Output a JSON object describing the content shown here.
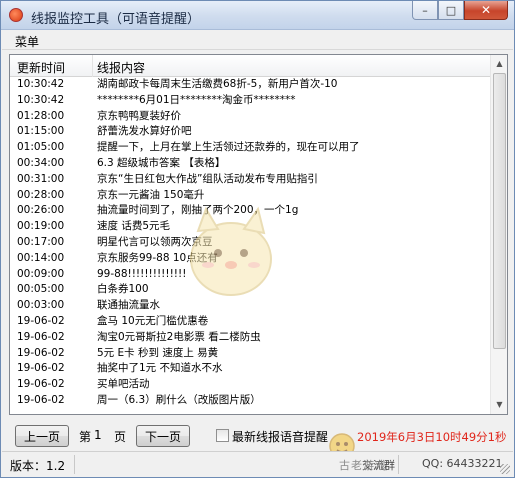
{
  "window": {
    "title": "线报监控工具（可语音提醒）",
    "buttons": {
      "minimize": "–",
      "maximize": "□",
      "close": "✕"
    }
  },
  "menu": {
    "items": [
      "菜单"
    ]
  },
  "list": {
    "columns": [
      "更新时间",
      "线报内容"
    ],
    "rows": [
      [
        "10:30:42",
        "湖南邮政卡每周末生活缴费68折-5，新用户首次-10"
      ],
      [
        "10:30:42",
        "********6月01日********淘金币********"
      ],
      [
        "01:28:00",
        "京东鸭鸭夏装好价"
      ],
      [
        "01:15:00",
        "舒蕾洗发水算好价吧"
      ],
      [
        "01:05:00",
        "提醒一下，上月在掌上生活领过还款券的，现在可以用了"
      ],
      [
        "00:34:00",
        "6.3 超级城市答案 【表格】"
      ],
      [
        "00:31:00",
        "京东“生日红包大作战”组队活动发布专用贴指引"
      ],
      [
        "00:28:00",
        "京东一元酱油 150毫升"
      ],
      [
        "00:26:00",
        "抽流量时间到了，刚抽了两个200，一个1g"
      ],
      [
        "00:19:00",
        "速度 话费5元毛"
      ],
      [
        "00:17:00",
        "明星代言可以领两次京豆"
      ],
      [
        "00:14:00",
        "京东服务99-88 10点还有"
      ],
      [
        "00:09:00",
        "99-88!!!!!!!!!!!!!!"
      ],
      [
        "00:05:00",
        "白条券100"
      ],
      [
        "00:03:00",
        "联通抽流量水"
      ],
      [
        "19-06-02",
        "盒马 10元无门槛优惠卷"
      ],
      [
        "19-06-02",
        "淘宝0元哥斯拉2电影票 看二楼防虫"
      ],
      [
        "19-06-02",
        "5元 E卡 秒到 速度上 易黄"
      ],
      [
        "19-06-02",
        "抽奖中了1元 不知道水不水"
      ],
      [
        "19-06-02",
        "买单吧活动"
      ],
      [
        "19-06-02",
        "周一（6.3）刷什么（改版图片版）"
      ]
    ]
  },
  "pager": {
    "prev": "上一页",
    "page_prefix": "第",
    "page_number": "1",
    "page_suffix": "页",
    "next": "下一页"
  },
  "voice_alert": {
    "label": "最新线报语音提醒",
    "checked": false
  },
  "clock": "2019年6月3日10时49分1秒",
  "status": {
    "version": "版本：1.2",
    "qq_label": "交流群",
    "qq_number": "QQ: 64433221"
  },
  "watermark": {
    "text": "古老游戏",
    "sub": "GAME"
  },
  "colors": {
    "clock": "#e0261b",
    "titlebar": "#cfdcee"
  }
}
